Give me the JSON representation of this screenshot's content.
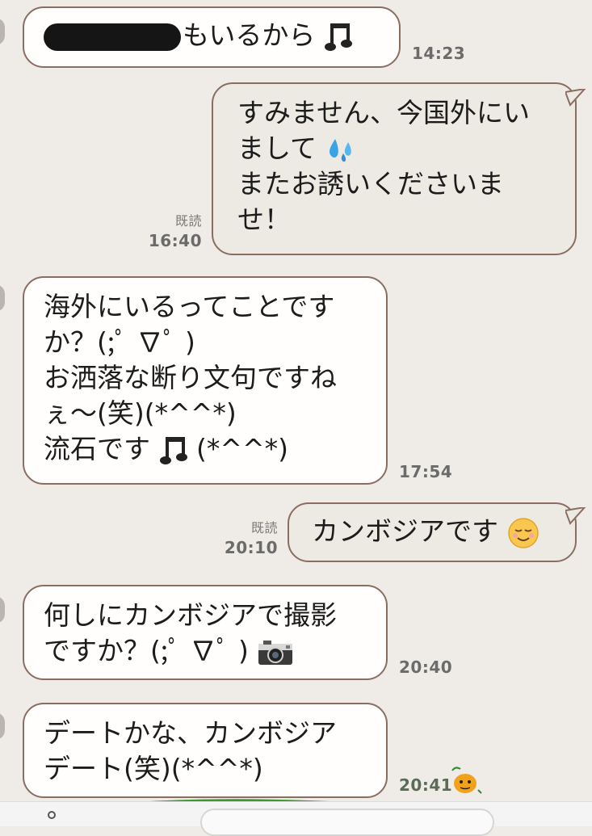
{
  "messages": [
    {
      "id": "m1",
      "side": "in",
      "lines": [
        "もいるから"
      ],
      "redacted_prefix": true,
      "emoji": "music-notes",
      "time": "14:23"
    },
    {
      "id": "m2",
      "side": "out",
      "lines": [
        "すみません、今国外にい",
        "まして",
        "またお誘いくださいま",
        "せ！"
      ],
      "emoji_line": 1,
      "emoji": "sweat-drops",
      "read": "既読",
      "time": "16:40"
    },
    {
      "id": "m3",
      "side": "in",
      "lines": [
        "海外にいるってことです",
        "か？(;ﾟ ∇ﾟ )",
        "お洒落な断り文句ですね",
        "ぇ～(笑)(*^^*)",
        "流石です",
        "(*^^*)"
      ],
      "emoji": "music-notes",
      "time": "17:54"
    },
    {
      "id": "m4",
      "side": "out",
      "lines": [
        "カンボジアです"
      ],
      "emoji": "relieved-face",
      "read": "既読",
      "time": "20:10"
    },
    {
      "id": "m5",
      "side": "in",
      "lines": [
        "何しにカンボジアで撮影",
        "ですか？(;ﾟ ∇ﾟ )"
      ],
      "emoji": "camera",
      "time": "20:40"
    },
    {
      "id": "m6",
      "side": "in",
      "lines": [
        "デートかな、カンボジア",
        "デート(笑)(*^^*)"
      ],
      "time": "20:41"
    }
  ],
  "m1_text": "もいるから",
  "m3_last_a": "流石です",
  "m3_last_b": "(*^^*)",
  "colors": {
    "background": "#efebe6",
    "bubble_in": "#fffefd",
    "bubble_out": "#ede9e3",
    "border": "#8a6e62",
    "ground": "#3a9a2c"
  }
}
